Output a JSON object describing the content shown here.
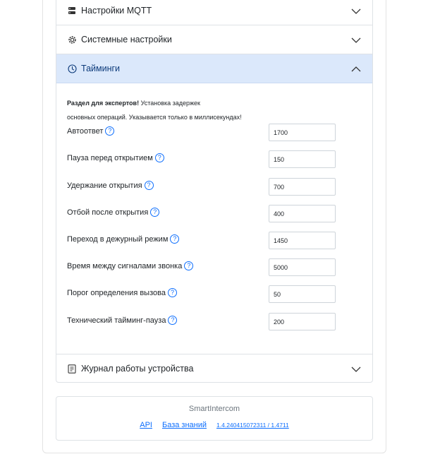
{
  "sections": {
    "mqtt": {
      "label": "Настройки MQTT",
      "icon": "server-icon"
    },
    "system": {
      "label": "Системные настройки",
      "icon": "gear-icon"
    },
    "timings": {
      "label": "Тайминги",
      "icon": "clock-icon",
      "expanded": true
    },
    "log": {
      "label": "Журнал работы устройства",
      "icon": "journal-icon"
    }
  },
  "timings": {
    "note_bold": "Раздел для экспертов!",
    "note_line1": " Установка задержек",
    "note_line2": "основных операций. Указывается только в миллисекундах!",
    "help_glyph": "?",
    "fields": [
      {
        "label": "Автоответ",
        "value": "1700"
      },
      {
        "label": "Пауза перед открытием",
        "value": "150"
      },
      {
        "label": "Удержание открытия",
        "value": "700"
      },
      {
        "label": "Отбой после открытия",
        "value": "400"
      },
      {
        "label": "Переход в дежурный режим",
        "value": "1450"
      },
      {
        "label": "Время между сигналами звонка",
        "value": "5000"
      },
      {
        "label": "Порог определения вызова",
        "value": "50"
      },
      {
        "label": "Технический тайминг-пауза",
        "value": "200"
      }
    ]
  },
  "footer": {
    "brand": "SmartIntercom",
    "api_link": "API",
    "kb_link": "База знаний",
    "version_link": "1.4.240415072311 / 1.4711"
  },
  "colors": {
    "accent": "#0d6efd",
    "active_header": "#dbe8fb"
  }
}
